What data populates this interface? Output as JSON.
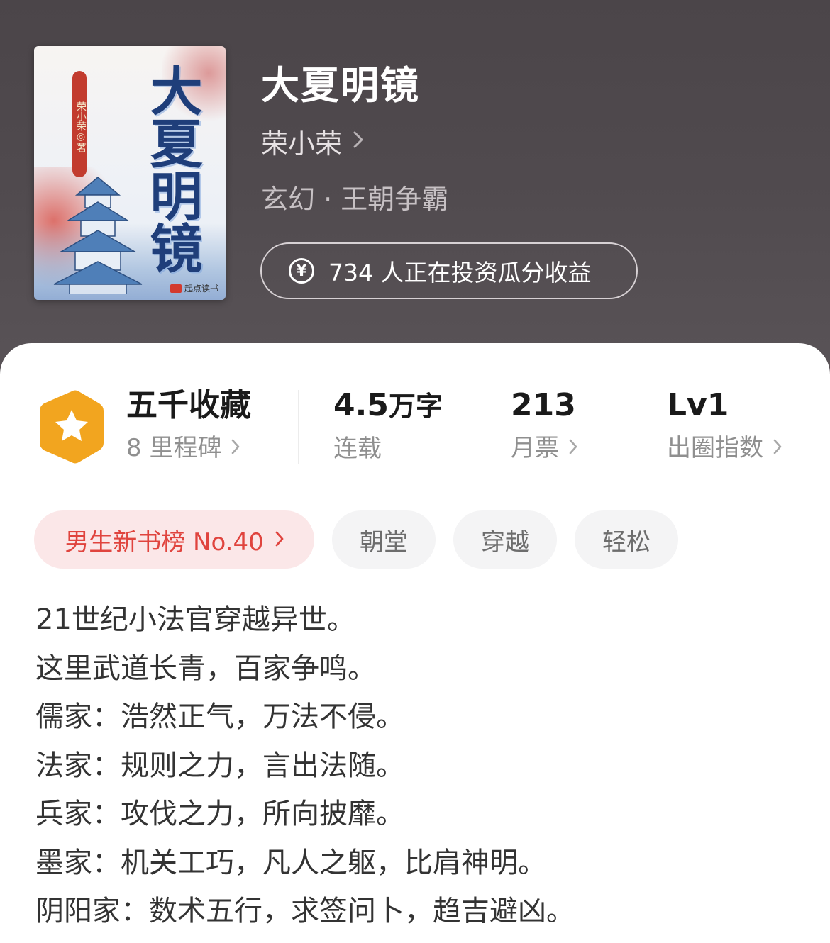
{
  "book": {
    "title": "大夏明镜",
    "author": "荣小荣",
    "genre": "玄幻 · 王朝争霸",
    "invest_text": "734 人正在投资瓜分收益"
  },
  "cover": {
    "title_text": "大夏明镜",
    "author_seal": "荣小荣◎著",
    "publisher": "起点读书"
  },
  "stats": {
    "collection": {
      "value": "五千收藏",
      "label": "8 里程碑"
    },
    "words": {
      "value": "4.5",
      "unit": "万字",
      "label": "连载"
    },
    "monthly_tickets": {
      "value": "213",
      "label": "月票"
    },
    "influence": {
      "value": "Lv1",
      "label": "出圈指数"
    }
  },
  "tags": {
    "rank": "男生新书榜 No.40",
    "items": [
      "朝堂",
      "穿越",
      "轻松"
    ]
  },
  "description": [
    "21世纪小法官穿越异世。",
    "这里武道长青，百家争鸣。",
    "儒家：浩然正气，万法不侵。",
    "法家：规则之力，言出法随。",
    "兵家：攻伐之力，所向披靡。",
    "墨家：机关工巧，凡人之躯，比肩神明。",
    "阴阳家：数术五行，求签问卜，趋吉避凶。"
  ],
  "colors": {
    "header_bg": "#4d474b",
    "rank_tag_text": "#e0443e",
    "rank_tag_bg": "#fbe7e8",
    "badge": "#f2a51f"
  },
  "icons": {
    "yen": "yen-circle-icon",
    "badge": "star-hexagon-icon",
    "chevron": "chevron-right-icon"
  }
}
